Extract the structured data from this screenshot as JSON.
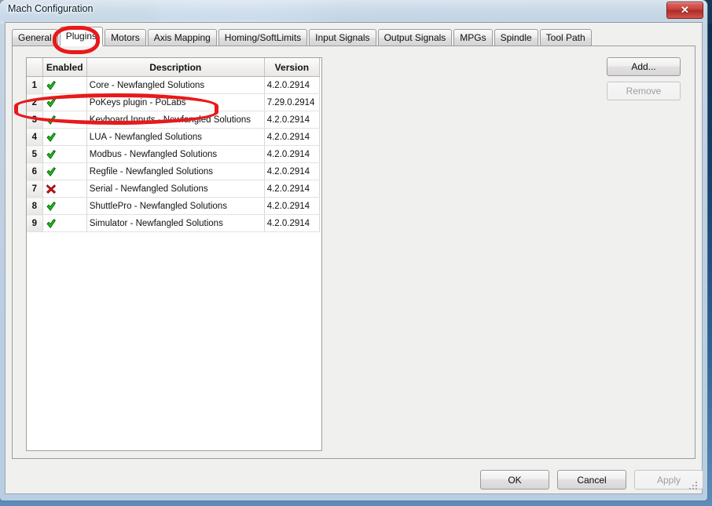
{
  "window": {
    "title": "Mach Configuration",
    "close_label": "✕"
  },
  "tabs": [
    {
      "label": "General",
      "active": false
    },
    {
      "label": "Plugins",
      "active": true
    },
    {
      "label": "Motors",
      "active": false
    },
    {
      "label": "Axis Mapping",
      "active": false
    },
    {
      "label": "Homing/SoftLimits",
      "active": false
    },
    {
      "label": "Input Signals",
      "active": false
    },
    {
      "label": "Output Signals",
      "active": false
    },
    {
      "label": "MPGs",
      "active": false
    },
    {
      "label": "Spindle",
      "active": false
    },
    {
      "label": "Tool Path",
      "active": false
    }
  ],
  "grid": {
    "headers": {
      "row": "",
      "enabled": "Enabled",
      "description": "Description",
      "version": "Version"
    },
    "rows": [
      {
        "num": "1",
        "enabled": true,
        "icon": "green-check-icon",
        "description": "Core - Newfangled Solutions",
        "version": "4.2.0.2914"
      },
      {
        "num": "2",
        "enabled": true,
        "icon": "green-check-icon",
        "description": "PoKeys plugin - PoLabs",
        "version": "7.29.0.2914"
      },
      {
        "num": "3",
        "enabled": true,
        "icon": "green-check-icon",
        "description": "Keyboard Inputs - Newfangled Solutions",
        "version": "4.2.0.2914"
      },
      {
        "num": "4",
        "enabled": true,
        "icon": "green-check-icon",
        "description": "LUA - Newfangled Solutions",
        "version": "4.2.0.2914"
      },
      {
        "num": "5",
        "enabled": true,
        "icon": "green-check-icon",
        "description": "Modbus - Newfangled Solutions",
        "version": "4.2.0.2914"
      },
      {
        "num": "6",
        "enabled": true,
        "icon": "green-check-icon",
        "description": "Regfile - Newfangled Solutions",
        "version": "4.2.0.2914"
      },
      {
        "num": "7",
        "enabled": false,
        "icon": "red-x-icon",
        "description": "Serial - Newfangled Solutions",
        "version": "4.2.0.2914"
      },
      {
        "num": "8",
        "enabled": true,
        "icon": "green-check-icon",
        "description": "ShuttlePro - Newfangled Solutions",
        "version": "4.2.0.2914"
      },
      {
        "num": "9",
        "enabled": true,
        "icon": "green-check-icon",
        "description": "Simulator - Newfangled Solutions",
        "version": "4.2.0.2914"
      }
    ]
  },
  "side_buttons": {
    "add": {
      "label": "Add...",
      "enabled": true
    },
    "remove": {
      "label": "Remove",
      "enabled": false
    }
  },
  "dialog_buttons": {
    "ok": {
      "label": "OK",
      "enabled": true
    },
    "cancel": {
      "label": "Cancel",
      "enabled": true
    },
    "apply": {
      "label": "Apply",
      "enabled": false
    }
  },
  "annotations": [
    {
      "name": "plugins-tab-highlight",
      "color": "#e8191b",
      "shape": "ellipse"
    },
    {
      "name": "pokeys-row-highlight",
      "color": "#e8191b",
      "shape": "ellipse"
    }
  ]
}
